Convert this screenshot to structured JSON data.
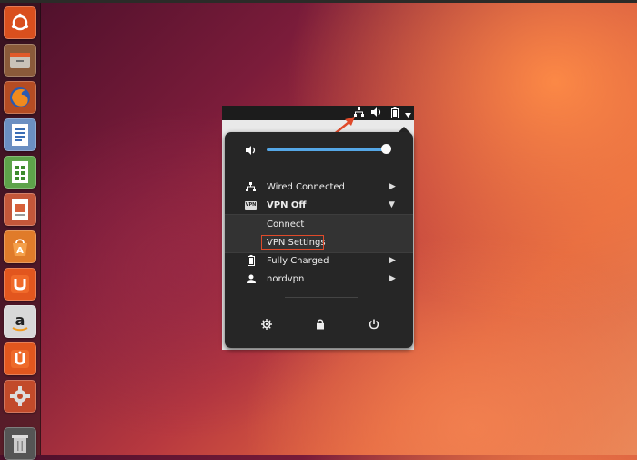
{
  "launcher": {
    "icons": [
      "ubuntu-dash-icon",
      "files-icon",
      "firefox-icon",
      "writer-icon",
      "calc-icon",
      "impress-icon",
      "software-center-icon",
      "ubuntu-one-icon",
      "amazon-icon",
      "ubuntu-one-music-icon",
      "system-settings-icon",
      "trash-icon"
    ]
  },
  "tray": {
    "icons": [
      "network-icon",
      "volume-icon",
      "battery-icon",
      "dropdown-icon"
    ]
  },
  "menu": {
    "volume_level": 0.92,
    "items": [
      {
        "label": "Wired Connected",
        "icon": "network-icon",
        "has_submenu": true
      },
      {
        "label": "VPN Off",
        "icon": "vpn-icon",
        "expanded": true
      },
      {
        "label": "Connect"
      },
      {
        "label": "VPN Settings",
        "highlighted": true
      },
      {
        "label": "Fully Charged",
        "icon": "battery-icon",
        "has_submenu": true
      },
      {
        "label": "nordvpn",
        "icon": "user-icon",
        "has_submenu": true
      }
    ],
    "vpn_badge": "VPN",
    "bottom_buttons": [
      "settings-icon",
      "lock-icon",
      "power-icon"
    ]
  },
  "colors": {
    "menu_bg": "#262626",
    "slider_accent": "#55a7e6",
    "annotation": "#e04a2a"
  }
}
